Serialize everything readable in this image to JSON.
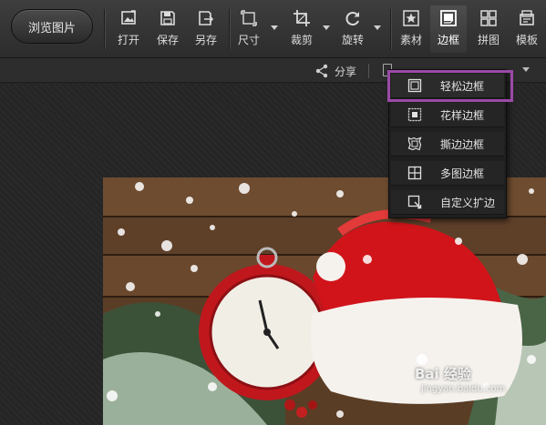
{
  "toolbar": {
    "browse_label": "浏览图片",
    "tools": [
      {
        "label": "打开",
        "icon": "open-image-icon"
      },
      {
        "label": "保存",
        "icon": "save-icon"
      },
      {
        "label": "另存",
        "icon": "save-as-icon"
      },
      {
        "label": "尺寸",
        "icon": "resize-icon"
      },
      {
        "label": "裁剪",
        "icon": "crop-icon"
      },
      {
        "label": "旋转",
        "icon": "rotate-icon"
      },
      {
        "label": "素材",
        "icon": "material-icon"
      },
      {
        "label": "边框",
        "icon": "border-icon"
      },
      {
        "label": "拼图",
        "icon": "collage-icon"
      },
      {
        "label": "模板",
        "icon": "template-icon"
      }
    ],
    "active_tool": "边框"
  },
  "subbar": {
    "share_label": "分享"
  },
  "border_menu": {
    "items": [
      {
        "label": "轻松边框",
        "icon": "simple-border-icon"
      },
      {
        "label": "花样边框",
        "icon": "pattern-border-icon"
      },
      {
        "label": "撕边边框",
        "icon": "torn-edge-border-icon"
      },
      {
        "label": "多图边框",
        "icon": "multi-image-border-icon"
      },
      {
        "label": "自定义扩边",
        "icon": "custom-extend-icon"
      }
    ],
    "highlighted": "轻松边框"
  },
  "watermark": {
    "text": "Bai 经验",
    "sub": "jingyan.baidu.com"
  },
  "colors": {
    "highlight": "#9b4aa8",
    "toolbar_bg": "#333333",
    "canvas_bg": "#252525"
  }
}
